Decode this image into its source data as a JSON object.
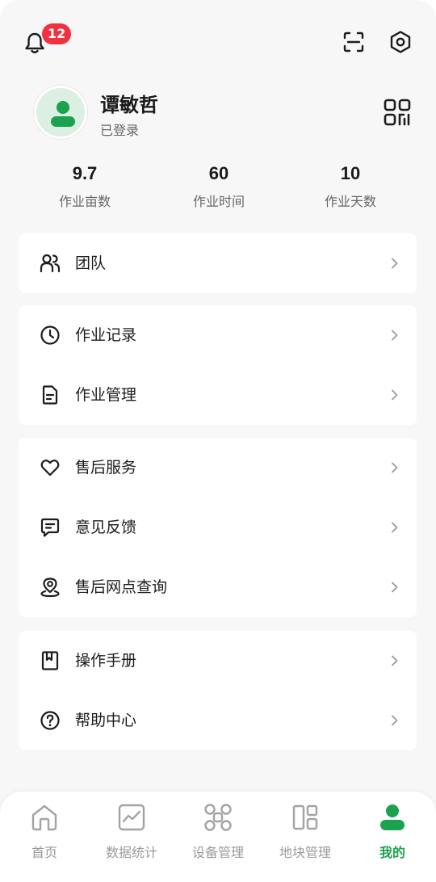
{
  "colors": {
    "accent": "#1aa24f",
    "badge": "#f2313f",
    "background": "#f7f7f7"
  },
  "header": {
    "notification_count": "12",
    "icons": [
      "bell-icon",
      "scan-icon",
      "settings-icon"
    ]
  },
  "profile": {
    "name": "谭敏哲",
    "status": "已登录",
    "icons": [
      "avatar",
      "qr-code-icon"
    ]
  },
  "stats": [
    {
      "value": "9.7",
      "label": "作业亩数"
    },
    {
      "value": "60",
      "label": "作业时间"
    },
    {
      "value": "10",
      "label": "作业天数"
    }
  ],
  "menu": {
    "team": {
      "label": "团队",
      "icon": "team-icon"
    },
    "work_records": {
      "label": "作业记录",
      "icon": "clock-icon"
    },
    "work_management": {
      "label": "作业管理",
      "icon": "document-icon"
    },
    "after_sales": {
      "label": "售后服务",
      "icon": "heart-icon"
    },
    "feedback": {
      "label": "意见反馈",
      "icon": "message-icon"
    },
    "service_outlets": {
      "label": "售后网点查询",
      "icon": "location-icon"
    },
    "manual": {
      "label": "操作手册",
      "icon": "book-icon"
    },
    "help_center": {
      "label": "帮助中心",
      "icon": "help-icon"
    }
  },
  "bottom_nav": [
    {
      "label": "首页",
      "icon": "home-icon"
    },
    {
      "label": "数据统计",
      "icon": "chart-icon"
    },
    {
      "label": "设备管理",
      "icon": "drone-icon"
    },
    {
      "label": "地块管理",
      "icon": "plots-icon"
    },
    {
      "label": "我的",
      "icon": "profile-icon",
      "active": true
    }
  ]
}
